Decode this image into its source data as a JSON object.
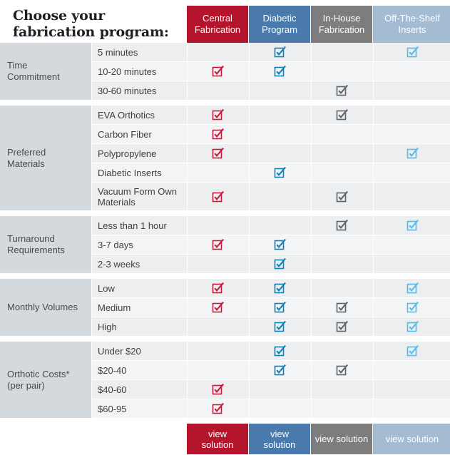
{
  "title": "Choose your\nfabrication program:",
  "colors": {
    "central": "#b5152c",
    "diabetic": "#4a7aac",
    "inhouse": "#7d7d7d",
    "offshelf": "#a4bcd2",
    "check_central": "#c41d3b",
    "check_diabetic": "#0c82b8",
    "check_inhouse": "#5c656b",
    "check_offshelf": "#55bbe8"
  },
  "columns": [
    {
      "key": "central",
      "label": "Central\nFabrication",
      "bg": "#b5152c",
      "check": "#c41d3b"
    },
    {
      "key": "diabetic",
      "label": "Diabetic\nProgram",
      "bg": "#4a7aac",
      "check": "#0c82b8"
    },
    {
      "key": "inhouse",
      "label": "In-House\nFabrication",
      "bg": "#7d7d7d",
      "check": "#5c656b"
    },
    {
      "key": "offshelf",
      "label": "Off-The-Shelf\nInserts",
      "bg": "#a4bcd2",
      "check": "#55bbe8"
    }
  ],
  "sections": [
    {
      "category": "Time\nCommitment",
      "rows": [
        {
          "label": "5 minutes",
          "marks": [
            false,
            true,
            false,
            true
          ]
        },
        {
          "label": "10-20 minutes",
          "marks": [
            true,
            true,
            false,
            false
          ]
        },
        {
          "label": "30-60 minutes",
          "marks": [
            false,
            false,
            true,
            false
          ]
        }
      ]
    },
    {
      "category": "Preferred\nMaterials",
      "rows": [
        {
          "label": "EVA Orthotics",
          "marks": [
            true,
            false,
            true,
            false
          ]
        },
        {
          "label": "Carbon Fiber",
          "marks": [
            true,
            false,
            false,
            false
          ]
        },
        {
          "label": "Polypropylene",
          "marks": [
            true,
            false,
            false,
            true
          ]
        },
        {
          "label": "Diabetic Inserts",
          "marks": [
            false,
            true,
            false,
            false
          ]
        },
        {
          "label": "Vacuum Form Own Materials",
          "marks": [
            true,
            false,
            true,
            false
          ],
          "tall": true
        }
      ]
    },
    {
      "category": "Turnaround\nRequirements",
      "rows": [
        {
          "label": "Less than 1 hour",
          "marks": [
            false,
            false,
            true,
            true
          ]
        },
        {
          "label": "3-7 days",
          "marks": [
            true,
            true,
            false,
            false
          ]
        },
        {
          "label": "2-3 weeks",
          "marks": [
            false,
            true,
            false,
            false
          ]
        }
      ]
    },
    {
      "category": "Monthly Volumes",
      "rows": [
        {
          "label": "Low",
          "marks": [
            true,
            true,
            false,
            true
          ]
        },
        {
          "label": "Medium",
          "marks": [
            true,
            true,
            true,
            true
          ]
        },
        {
          "label": "High",
          "marks": [
            false,
            true,
            true,
            true
          ]
        }
      ]
    },
    {
      "category": "Orthotic Costs*\n(per pair)",
      "rows": [
        {
          "label": "Under $20",
          "marks": [
            false,
            true,
            false,
            true
          ]
        },
        {
          "label": "$20-40",
          "marks": [
            false,
            true,
            true,
            false
          ]
        },
        {
          "label": "$40-60",
          "marks": [
            true,
            false,
            false,
            false
          ]
        },
        {
          "label": "$60-95",
          "marks": [
            true,
            false,
            false,
            false
          ]
        }
      ]
    }
  ],
  "footer": {
    "buttons": [
      {
        "label": "view\nsolution",
        "bg": "#b5152c"
      },
      {
        "label": "view\nsolution",
        "bg": "#4a7aac"
      },
      {
        "label": "view solution",
        "bg": "#7d7d7d"
      },
      {
        "label": "view solution",
        "bg": "#a4bcd2"
      }
    ]
  }
}
